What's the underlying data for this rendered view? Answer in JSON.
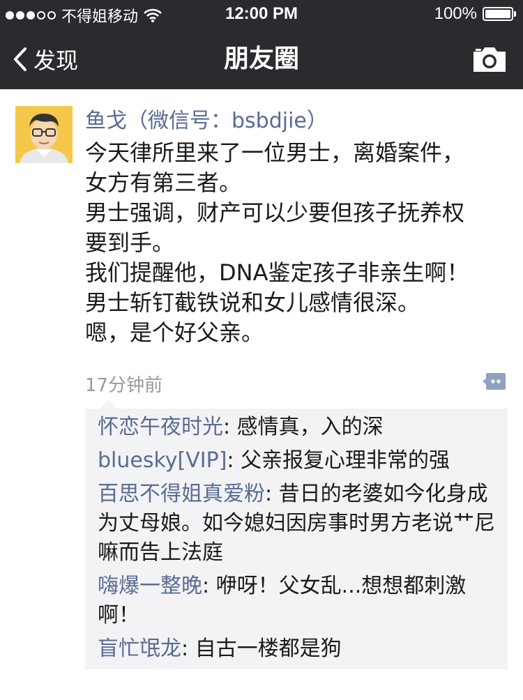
{
  "status_bar": {
    "carrier": "不得姐移动",
    "time": "12:00 PM",
    "battery": "100%",
    "signal_bars_filled": 3,
    "signal_bars_total": 5
  },
  "nav": {
    "back_label": "发现",
    "title": "朋友圈"
  },
  "post": {
    "author": "鱼戈（微信号：bsbdjie）",
    "lines": [
      "今天律所里来了一位男士，离婚案件，",
      "女方有第三者。",
      "男士强调，财产可以少要但孩子抚养权",
      "要到手。",
      "我们提醒他，DNA鉴定孩子非亲生啊！",
      "男士斩钉截铁说和女儿感情很深。",
      "嗯，是个好父亲。"
    ],
    "time_ago": "17分钟前"
  },
  "comments": [
    {
      "name": "怀恋午夜时光",
      "sep": ": ",
      "text": "感情真，入的深"
    },
    {
      "name": "bluesky[VIP]",
      "sep": ": ",
      "text": "父亲报复心理非常的强"
    },
    {
      "name": "百思不得姐真爱粉",
      "sep": ": ",
      "text": "昔日的老婆如今化身成为丈母娘。如今媳妇因房事时男方老说艹尼嘛而告上法庭"
    },
    {
      "name": "嗨爆一整晚",
      "sep": ": ",
      "text": "咿呀！父女乱...想想都刺激啊！"
    },
    {
      "name": "盲忙氓龙",
      "sep": ": ",
      "text": "自古一楼都是狗"
    }
  ],
  "colors": {
    "header_bg": "#2b2a2f",
    "link_blue": "#586b95",
    "comments_bg": "#f3f3f5",
    "timestamp_gray": "#9a9a9a"
  }
}
